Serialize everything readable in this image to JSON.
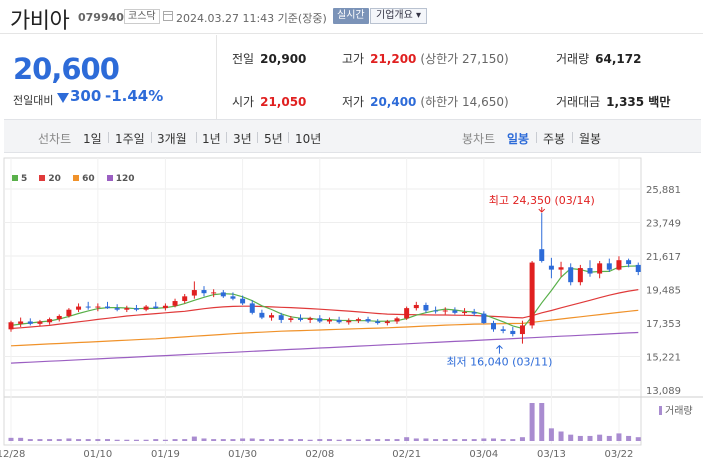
{
  "header": {
    "name": "가비아",
    "code": "079940",
    "market": "코스닥",
    "datetime": "2024.03.27 11:43 기준(장중)",
    "realtime": "실시간",
    "company_info": "기업개요 ▾"
  },
  "summary": {
    "price": "20,600",
    "diff_label": "전일대비",
    "diff_value": "300",
    "diff_rate": "-1.44%",
    "prev_close_label": "전일",
    "prev_close": "20,900",
    "high_label": "고가",
    "high": "21,200",
    "high_sub": "(상한가 27,150)",
    "volume_label": "거래량",
    "volume": "64,172",
    "open_label": "시가",
    "open": "21,050",
    "low_label": "저가",
    "low": "20,400",
    "low_sub": "(하한가 14,650)",
    "amount_label": "거래대금",
    "amount": "1,335 백만"
  },
  "period": {
    "line_label": "선차트",
    "line_items": [
      "1일",
      "1주일",
      "3개월",
      "1년",
      "3년",
      "5년",
      "10년"
    ],
    "candle_label": "봉차트",
    "candle_items": [
      "일봉",
      "주봉",
      "월봉"
    ],
    "active": "일봉"
  },
  "colors": {
    "up": "#e02020",
    "down": "#2d6bd8",
    "ma5": "#59b04a",
    "ma20": "#e03a3a",
    "ma60": "#f0922a",
    "ma120": "#9b5fc2",
    "volume": "#a98cd0"
  },
  "chart_data": {
    "type": "candlestick",
    "legend": [
      "5",
      "20",
      "60",
      "120"
    ],
    "y_ticks": [
      "25,881",
      "23,749",
      "21,617",
      "19,485",
      "17,353",
      "15,221",
      "13,089"
    ],
    "y_values": [
      25881,
      23749,
      21617,
      19485,
      17353,
      15221,
      13089
    ],
    "x_ticks": [
      "12/28",
      "01/10",
      "01/19",
      "01/30",
      "02/08",
      "02/21",
      "03/04",
      "03/13",
      "03/22"
    ],
    "max_annotation": "최고 24,350 (03/14)",
    "min_annotation": "최저 16,040 (03/11)",
    "volume_label": "거래량",
    "candles": [
      [
        16950,
        17500,
        16800,
        17400
      ],
      [
        17300,
        17700,
        17100,
        17450
      ],
      [
        17450,
        17650,
        17200,
        17300
      ],
      [
        17300,
        17550,
        17150,
        17450
      ],
      [
        17400,
        17700,
        17250,
        17600
      ],
      [
        17600,
        17900,
        17450,
        17800
      ],
      [
        17800,
        18300,
        17700,
        18200
      ],
      [
        18200,
        18600,
        18050,
        18400
      ],
      [
        18400,
        18700,
        18200,
        18350
      ],
      [
        18350,
        18600,
        18100,
        18400
      ],
      [
        18400,
        18700,
        18250,
        18300
      ],
      [
        18300,
        18550,
        18100,
        18200
      ],
      [
        18200,
        18450,
        18050,
        18300
      ],
      [
        18300,
        18500,
        18100,
        18200
      ],
      [
        18200,
        18500,
        18100,
        18400
      ],
      [
        18400,
        18700,
        18250,
        18300
      ],
      [
        18300,
        18600,
        18150,
        18450
      ],
      [
        18450,
        18900,
        18350,
        18750
      ],
      [
        18750,
        19200,
        18600,
        19050
      ],
      [
        19100,
        20000,
        18900,
        19450
      ],
      [
        19450,
        19700,
        19050,
        19250
      ],
      [
        19250,
        19500,
        19000,
        19300
      ],
      [
        19300,
        19450,
        18950,
        19050
      ],
      [
        19050,
        19300,
        18800,
        18900
      ],
      [
        18900,
        19100,
        18500,
        18600
      ],
      [
        18600,
        18800,
        17900,
        18000
      ],
      [
        18000,
        18200,
        17600,
        17700
      ],
      [
        17700,
        18000,
        17500,
        17850
      ],
      [
        17850,
        18000,
        17350,
        17550
      ],
      [
        17550,
        17800,
        17400,
        17650
      ],
      [
        17650,
        17900,
        17450,
        17550
      ],
      [
        17550,
        17750,
        17350,
        17650
      ],
      [
        17650,
        17850,
        17350,
        17450
      ],
      [
        17450,
        17700,
        17300,
        17550
      ],
      [
        17550,
        17750,
        17300,
        17400
      ],
      [
        17400,
        17650,
        17250,
        17500
      ],
      [
        17500,
        17700,
        17350,
        17600
      ],
      [
        17600,
        17750,
        17350,
        17450
      ],
      [
        17450,
        17600,
        17250,
        17350
      ],
      [
        17350,
        17550,
        17200,
        17450
      ],
      [
        17450,
        17750,
        17300,
        17650
      ],
      [
        17650,
        18400,
        17550,
        18300
      ],
      [
        18300,
        18700,
        18150,
        18500
      ],
      [
        18500,
        18650,
        18000,
        18150
      ],
      [
        18150,
        18400,
        17950,
        18100
      ],
      [
        18100,
        18350,
        17900,
        18150
      ],
      [
        18150,
        18350,
        17900,
        18000
      ],
      [
        18000,
        18300,
        17850,
        18050
      ],
      [
        18050,
        18250,
        17800,
        17950
      ],
      [
        17950,
        18100,
        17300,
        17350
      ],
      [
        17350,
        17500,
        16800,
        16950
      ],
      [
        16950,
        17150,
        16700,
        16850
      ],
      [
        16850,
        17100,
        16500,
        16650
      ],
      [
        16650,
        17500,
        16040,
        17200
      ],
      [
        17200,
        21300,
        17000,
        21200
      ],
      [
        22050,
        24350,
        21200,
        21300
      ],
      [
        21000,
        21500,
        20200,
        20750
      ],
      [
        20750,
        21250,
        20300,
        20900
      ],
      [
        20900,
        21150,
        19750,
        19950
      ],
      [
        19950,
        21050,
        19750,
        20850
      ],
      [
        20850,
        21350,
        20300,
        20500
      ],
      [
        20500,
        21300,
        20200,
        21150
      ],
      [
        21150,
        21450,
        20600,
        20750
      ],
      [
        20750,
        21600,
        20700,
        21350
      ],
      [
        21350,
        21450,
        20900,
        21100
      ],
      [
        21050,
        21200,
        20400,
        20600
      ]
    ],
    "ma5": [
      [
        16950,
        17200
      ],
      [
        17300,
        17280
      ],
      [
        17300,
        17350
      ],
      [
        17450,
        17420
      ],
      [
        17600,
        17480
      ],
      [
        17800,
        17610
      ],
      [
        18200,
        17770
      ],
      [
        18400,
        17960
      ],
      [
        18350,
        18120
      ],
      [
        18400,
        18270
      ],
      [
        18300,
        18330
      ],
      [
        18200,
        18330
      ],
      [
        18300,
        18310
      ],
      [
        18200,
        18260
      ],
      [
        18400,
        18280
      ],
      [
        18300,
        18280
      ],
      [
        18450,
        18330
      ],
      [
        18750,
        18420
      ],
      [
        19050,
        18590
      ],
      [
        19450,
        18800
      ],
      [
        19250,
        18990
      ],
      [
        19300,
        19160
      ],
      [
        19050,
        19220
      ],
      [
        18900,
        19190
      ],
      [
        18600,
        19020
      ],
      [
        18000,
        18770
      ],
      [
        17700,
        18450
      ],
      [
        17850,
        18210
      ],
      [
        17550,
        17940
      ],
      [
        17650,
        17750
      ],
      [
        17550,
        17660
      ],
      [
        17650,
        17650
      ],
      [
        17450,
        17570
      ],
      [
        17550,
        17570
      ],
      [
        17400,
        17520
      ],
      [
        17500,
        17510
      ],
      [
        17600,
        17500
      ],
      [
        17450,
        17500
      ],
      [
        17350,
        17460
      ],
      [
        17450,
        17470
      ],
      [
        17650,
        17500
      ],
      [
        18300,
        17640
      ],
      [
        18500,
        17850
      ],
      [
        18150,
        18010
      ],
      [
        18100,
        18140
      ],
      [
        18150,
        18240
      ],
      [
        18000,
        18180
      ],
      [
        18050,
        18090
      ],
      [
        17950,
        18050
      ],
      [
        17350,
        17900
      ],
      [
        16950,
        17660
      ],
      [
        16850,
        17430
      ],
      [
        16650,
        17170
      ],
      [
        17200,
        17000
      ],
      [
        21200,
        17770
      ],
      [
        21300,
        18640
      ],
      [
        20750,
        19420
      ],
      [
        20900,
        20270
      ],
      [
        19950,
        20820
      ],
      [
        20850,
        20750
      ],
      [
        20500,
        20590
      ],
      [
        21150,
        20630
      ],
      [
        20750,
        20640
      ],
      [
        21350,
        20920
      ],
      [
        21100,
        20970
      ],
      [
        20600,
        20990
      ]
    ],
    "ma20": [
      17000,
      17050,
      17100,
      17150,
      17200,
      17280,
      17350,
      17430,
      17500,
      17580,
      17650,
      17720,
      17800,
      17850,
      17900,
      17950,
      18000,
      18050,
      18100,
      18180,
      18260,
      18330,
      18380,
      18410,
      18420,
      18420,
      18400,
      18380,
      18350,
      18330,
      18300,
      18270,
      18230,
      18190,
      18150,
      18110,
      18060,
      18010,
      17960,
      17920,
      17900,
      17890,
      17880,
      17870,
      17860,
      17860,
      17850,
      17840,
      17830,
      17800,
      17770,
      17740,
      17700,
      17680,
      17820,
      18000,
      18150,
      18320,
      18480,
      18640,
      18800,
      18960,
      19120,
      19260,
      19380,
      19480
    ],
    "ma60": [
      15900,
      15930,
      15960,
      15990,
      16020,
      16050,
      16080,
      16110,
      16140,
      16170,
      16200,
      16230,
      16260,
      16290,
      16320,
      16350,
      16390,
      16430,
      16470,
      16510,
      16550,
      16590,
      16630,
      16670,
      16710,
      16740,
      16770,
      16800,
      16830,
      16850,
      16870,
      16890,
      16910,
      16930,
      16950,
      16970,
      16990,
      17010,
      17030,
      17050,
      17070,
      17100,
      17130,
      17160,
      17190,
      17220,
      17240,
      17260,
      17280,
      17290,
      17300,
      17310,
      17320,
      17330,
      17400,
      17470,
      17540,
      17610,
      17680,
      17750,
      17820,
      17890,
      17960,
      18030,
      18100,
      18160
    ],
    "ma120": [
      14800,
      14830,
      14860,
      14890,
      14920,
      14950,
      14980,
      15010,
      15040,
      15070,
      15100,
      15130,
      15160,
      15190,
      15220,
      15250,
      15280,
      15310,
      15340,
      15370,
      15400,
      15430,
      15460,
      15490,
      15520,
      15550,
      15580,
      15610,
      15640,
      15670,
      15700,
      15730,
      15760,
      15790,
      15820,
      15850,
      15880,
      15910,
      15940,
      15970,
      16000,
      16030,
      16060,
      16090,
      16120,
      16150,
      16180,
      16210,
      16240,
      16270,
      16300,
      16330,
      16360,
      16390,
      16420,
      16450,
      16480,
      16510,
      16540,
      16570,
      16600,
      16630,
      16660,
      16690,
      16720,
      16750
    ],
    "volumes": [
      5,
      5,
      3,
      3,
      3,
      3,
      4,
      3,
      3,
      3,
      3,
      2,
      2,
      2,
      2,
      3,
      2,
      3,
      3,
      7,
      4,
      3,
      3,
      3,
      4,
      4,
      3,
      3,
      3,
      3,
      3,
      2,
      3,
      3,
      2,
      3,
      2,
      3,
      3,
      3,
      3,
      6,
      4,
      4,
      3,
      3,
      3,
      3,
      3,
      4,
      4,
      3,
      3,
      6,
      60,
      60,
      20,
      15,
      10,
      8,
      8,
      10,
      8,
      12,
      8,
      6
    ]
  }
}
